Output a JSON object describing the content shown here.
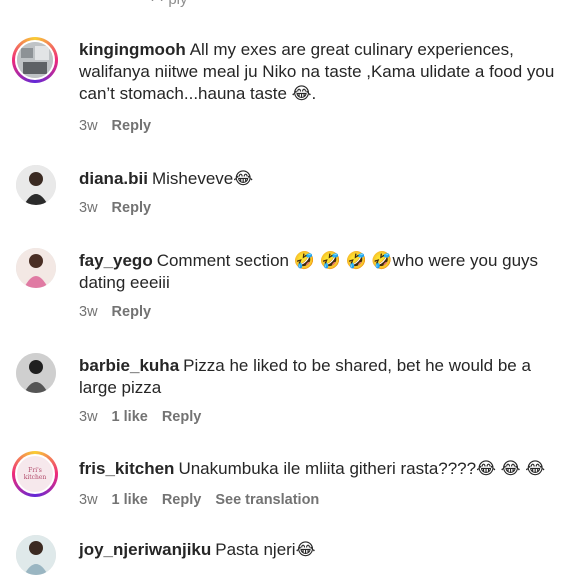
{
  "partial_top": "·  · ply",
  "comments": [
    {
      "username": "kingingmooh",
      "text": "All my exes are great culinary experiences, walifanya niitwe meal ju Niko na taste ,Kama ulidate a food you can’t stomach...hauna taste 😂.",
      "time": "3w",
      "reply": "Reply",
      "avatar_style": "story"
    },
    {
      "username": "diana.bii",
      "text": "Misheveve😂",
      "time": "3w",
      "reply": "Reply",
      "avatar_style": "plain"
    },
    {
      "username": "fay_yego",
      "text": "Comment section 🤣 🤣 🤣 🤣who were you guys dating eeeiii",
      "time": "3w",
      "reply": "Reply",
      "avatar_style": "plain"
    },
    {
      "username": "barbie_kuha",
      "text": "Pizza he liked to be shared, bet he would be a large pizza",
      "time": "3w",
      "likes": "1 like",
      "reply": "Reply",
      "avatar_style": "plain"
    },
    {
      "username": "fris_kitchen",
      "text": "Unakumbuka ile mliita githeri rasta????😂 😂 😂",
      "time": "3w",
      "likes": "1 like",
      "reply": "Reply",
      "see_translation": "See translation",
      "avatar_style": "story",
      "avatar_label": "Fri's kitchen"
    },
    {
      "username": "joy_njeriwanjiku",
      "text": "Pasta njeri😂",
      "avatar_style": "plain"
    }
  ],
  "colors": {
    "text": "#262626",
    "meta": "#737373",
    "story_ring": [
      "#f9ce34",
      "#ee2a7b",
      "#6228d7"
    ]
  }
}
